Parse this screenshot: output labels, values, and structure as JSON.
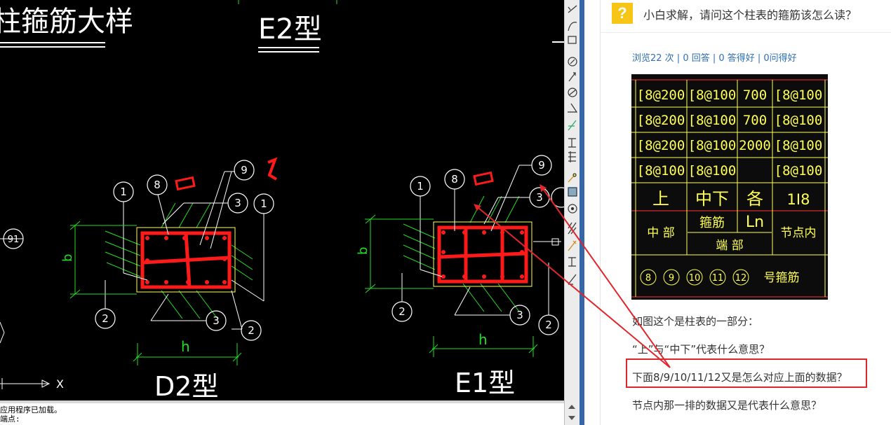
{
  "cad": {
    "title_left": "柱箍筋大样",
    "title_mid": "E2型",
    "label_d2": "D2型",
    "label_e1": "E1型",
    "dim_b": "b",
    "dim_h": "h",
    "axis_x": "X",
    "callouts": [
      "1",
      "8",
      "9",
      "3",
      "2",
      "91"
    ],
    "colors": {
      "background": "#000000",
      "rebar": "#ff1a1a",
      "line": "#ffffff",
      "dimension": "#22dd22",
      "outline": "#ffff66"
    }
  },
  "command_line": {
    "line1": "应用程序已加载。",
    "line2": "端点:"
  },
  "toolbar": {
    "icons": [
      "line-tool-icon",
      "arc-tool-icon",
      "dimension-tool-icon",
      "circle-tool-icon",
      "pointer-tool-icon",
      "no-tool-icon",
      "angle-tool-icon",
      "leader-tool-icon",
      "text-tool-icon",
      "mirror-tool-icon",
      "pen-tool-icon",
      "grid-tool-icon",
      "target-tool-icon",
      "hatch-tool-icon",
      "edit-tool-icon",
      "stretch-tool-icon",
      "measure-tool-icon"
    ]
  },
  "question": {
    "icon": "?",
    "title": "小白求解，请问这个柱表的箍筋该怎么读？",
    "stats": "浏览22 次 | 0 回答 | 0 答得好 | 0问得好",
    "table": {
      "rows": [
        [
          "[8@200",
          "[8@100",
          "700",
          "[8@100"
        ],
        [
          "[8@200",
          "[8@100",
          "700",
          "[8@100"
        ],
        [
          "[8@200",
          "[8@100",
          "2000",
          "[8@100"
        ],
        [
          "[8@100",
          "[8@100",
          "",
          "[8@100"
        ]
      ],
      "header_row": [
        "上",
        "中下",
        "各",
        "1I8"
      ],
      "sub_middle": "中 部",
      "sub_stirrup": "箍筋",
      "sub_ln": "Ln",
      "sub_node": "节点内",
      "sub_end": "端 部",
      "circled_numbers": [
        "8",
        "9",
        "10",
        "11",
        "12"
      ],
      "stirrup_label": "号箍筋",
      "colors": {
        "background": "#0c0c0c",
        "grid": "#ffff55",
        "text": "#ffff55",
        "red_line": "#ff3333"
      }
    },
    "paragraphs": [
      "如图这个是柱表的一部分：",
      "“上”与“中下”代表什么意思？",
      "下面8/9/10/11/12又是怎么对应上面的数据？",
      "节点内那一排的数据又是代表什么意思？"
    ],
    "accent_color": "#e0262c"
  }
}
